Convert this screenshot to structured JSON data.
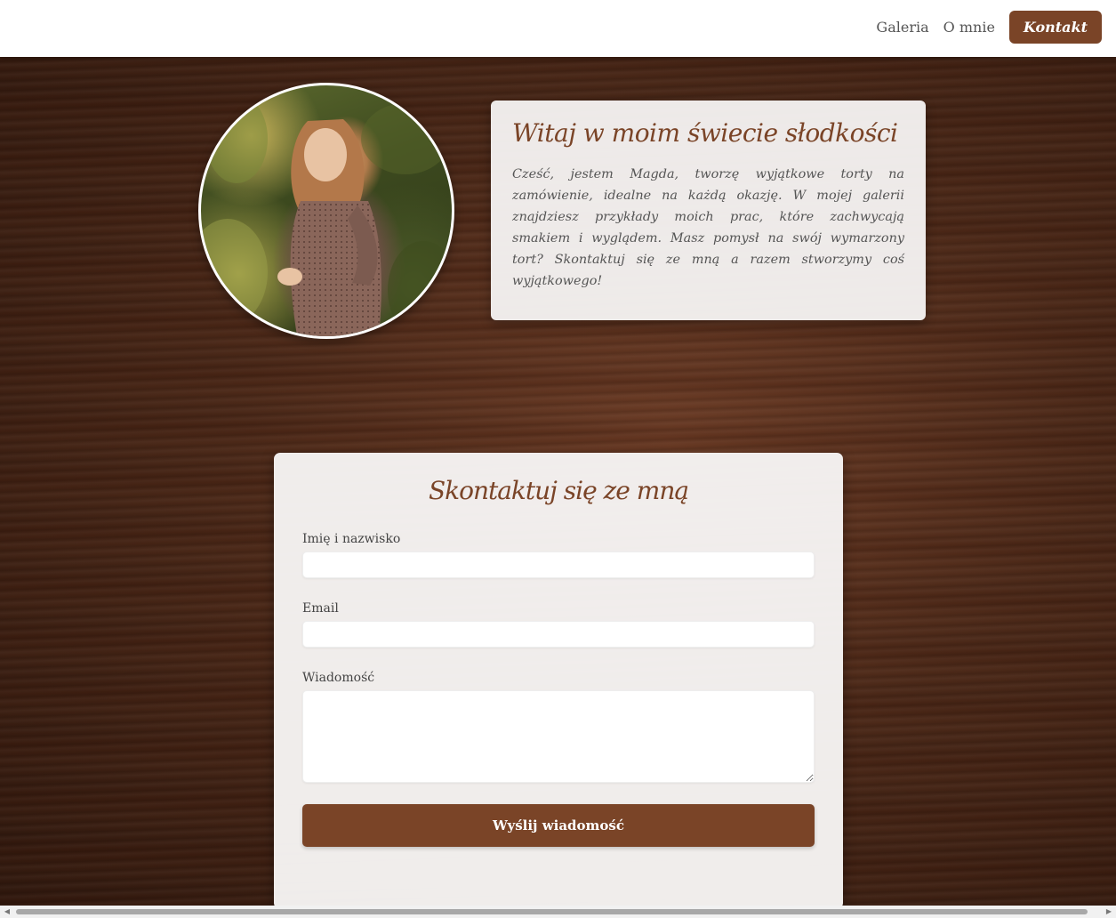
{
  "nav": {
    "items": [
      {
        "label": "Galeria",
        "active": false
      },
      {
        "label": "O mnie",
        "active": false
      },
      {
        "label": "Kontakt",
        "active": true
      }
    ]
  },
  "about": {
    "title": "Witaj w moim świecie słodkości",
    "text": "Cześć, jestem Magda, tworzę wyjątkowe torty na zamówienie, idealne na każdą okazję. W mojej galerii znajdziesz przykłady moich prac, które zachwycają smakiem i wyglądem. Masz pomysł na swój wymarzony tort? Skontaktuj się ze mną a razem stworzymy coś wyjątkowego!"
  },
  "contact_form": {
    "title": "Skontaktuj się ze mną",
    "name_label": "Imię i nazwisko",
    "name_value": "",
    "email_label": "Email",
    "email_value": "",
    "message_label": "Wiadomość",
    "message_value": "",
    "submit_label": "Wyślij wiadomość"
  },
  "colors": {
    "accent": "#7a4427",
    "card_background": "#f5f2f1",
    "nav_background": "#ffffff"
  },
  "icons": {
    "scroll_left": "chevron-left-icon",
    "scroll_right": "chevron-right-icon"
  }
}
